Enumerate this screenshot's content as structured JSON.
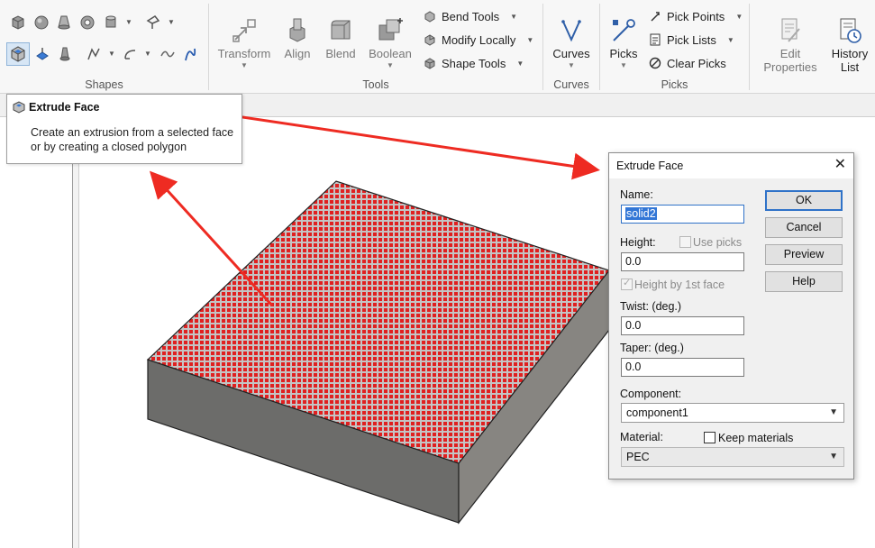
{
  "ribbon": {
    "groups": {
      "shapes": "Shapes",
      "tools": "Tools",
      "curves": "Curves",
      "picks": "Picks"
    },
    "tools": {
      "transform": "Transform",
      "align": "Align",
      "blend": "Blend",
      "boolean": "Boolean",
      "bend_tools": "Bend Tools",
      "modify_locally": "Modify Locally",
      "shape_tools": "Shape Tools"
    },
    "curves": {
      "curves": "Curves"
    },
    "picks": {
      "picks": "Picks",
      "pick_points": "Pick Points",
      "pick_lists": "Pick Lists",
      "clear_picks": "Clear Picks"
    },
    "edit_properties": {
      "line1": "Edit",
      "line2": "Properties"
    },
    "history_list": {
      "line1": "History",
      "line2": "List"
    }
  },
  "tooltip": {
    "title": "Extrude Face",
    "line1": "Create an extrusion from a selected face",
    "line2": "or by creating a closed polygon"
  },
  "dialog": {
    "title": "Extrude Face",
    "name_label": "Name:",
    "name_value": "solid2",
    "height_label": "Height:",
    "use_picks_label": "Use picks",
    "height_value": "0.0",
    "height_by_first_face_label": "Height by 1st face",
    "twist_label": "Twist: (deg.)",
    "twist_value": "0.0",
    "taper_label": "Taper: (deg.)",
    "taper_value": "0.0",
    "component_label": "Component:",
    "component_value": "component1",
    "material_label": "Material:",
    "keep_materials_label": "Keep materials",
    "material_value": "PEC",
    "buttons": {
      "ok": "OK",
      "cancel": "Cancel",
      "preview": "Preview",
      "help": "Help"
    }
  },
  "colors": {
    "face_pattern": "#e02020",
    "annotation_arrow": "#ee2b22",
    "box_side_front": "#6c6c6a",
    "box_side_right": "#878581"
  }
}
